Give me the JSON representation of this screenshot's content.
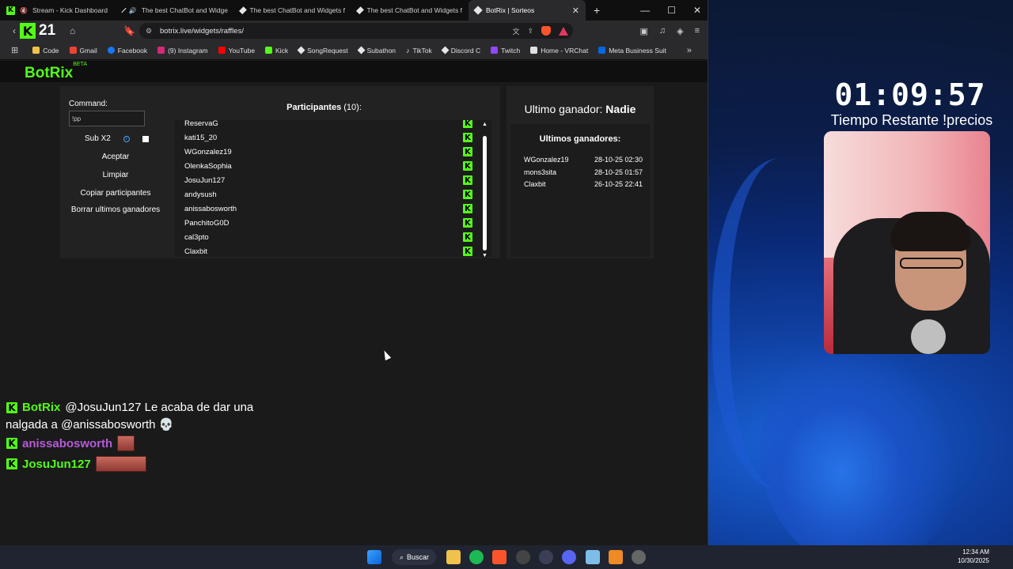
{
  "browser": {
    "tabs": [
      {
        "label": "Stream - Kick Dashboard",
        "icon": "kick-icon"
      },
      {
        "label": "The best ChatBot and Widge",
        "icon": "botrix-icon"
      },
      {
        "label": "The best ChatBot and Widgets f",
        "icon": "botrix-icon"
      },
      {
        "label": "The best ChatBot and Widgets f",
        "icon": "botrix-icon"
      },
      {
        "label": "BotRix | Sorteos",
        "icon": "botrix-icon",
        "active": true
      }
    ],
    "kick_count": "21",
    "url": "botrix.live/widgets/raffles/",
    "bookmarks": [
      {
        "label": "Code",
        "color": "#f0c24b"
      },
      {
        "label": "Gmail",
        "color": "#ea4335"
      },
      {
        "label": "Facebook",
        "color": "#1877f2"
      },
      {
        "label": "(9) Instagram",
        "color": "#d62976"
      },
      {
        "label": "YouTube",
        "color": "#ff0000"
      },
      {
        "label": "Kick",
        "color": "#53fc18"
      },
      {
        "label": "SongRequest",
        "color": "#e0e0e0"
      },
      {
        "label": "Subathon",
        "color": "#e0e0e0"
      },
      {
        "label": "TikTok",
        "color": "#ffffff"
      },
      {
        "label": "Discord C",
        "color": "#e0e0e0"
      },
      {
        "label": "Twitch",
        "color": "#9146ff"
      },
      {
        "label": "Home - VRChat",
        "color": "#e0e0e0"
      },
      {
        "label": "Meta Business Suit",
        "color": "#0668e1"
      }
    ]
  },
  "app": {
    "brand": "BotRix",
    "brand_badge": "BETA",
    "command_label": "Command:",
    "command_value": "!pp",
    "sub_label": "Sub X2",
    "buttons": {
      "accept": "Aceptar",
      "clear": "Limpiar",
      "copy": "Copiar participantes",
      "delete_winners": "Borrar ultimos ganadores"
    },
    "participants_label": "Participantes",
    "participants_count": "(10):",
    "participants": [
      "ReservaG",
      "kati15_20",
      "WGonzalez19",
      "OlenkaSophia",
      "JosuJun127",
      "andysush",
      "anissabosworth",
      "PanchitoG0D",
      "cal3pto",
      "Claxbit"
    ],
    "last_winner_label": "Ultimo ganador:",
    "last_winner_value": "Nadie",
    "winners_head": "Ultimos ganadores:",
    "winners": [
      {
        "name": "WGonzalez19",
        "date": "28-10-25 02:30"
      },
      {
        "name": "mons3sita",
        "date": "28-10-25 01:57"
      },
      {
        "name": "Claxbit",
        "date": "26-10-25 22:41"
      }
    ]
  },
  "chat": {
    "line1_user": "BotRix",
    "line1_text": "@JosuJun127 Le acaba de dar una",
    "line1_cont": "nalgada a @anissabosworth 💀",
    "line2_user": "anissabosworth",
    "line3_user": "JosuJun127"
  },
  "overlay": {
    "timer": "01:09:57",
    "timer_sub": "Tiempo Restante !precios"
  },
  "taskbar": {
    "search": "Buscar",
    "time": "12:34 AM",
    "date": "10/30/2025"
  },
  "colors": {
    "kick_green": "#53fc18",
    "purple_user": "#b65bd8"
  }
}
